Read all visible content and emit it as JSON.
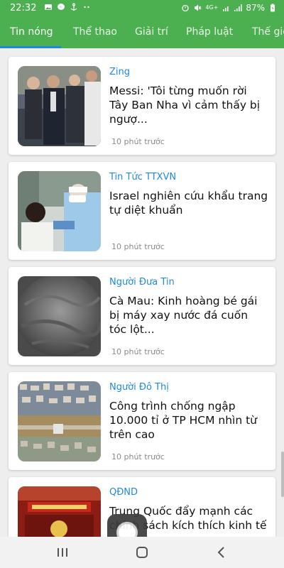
{
  "status_bar": {
    "time": "22:32",
    "network": "4G+",
    "battery": "87%",
    "icons_left": [
      "image-icon",
      "messenger-icon",
      "anchor-icon",
      "more-dots-icon"
    ],
    "icons_right": [
      "alarm-icon",
      "mute-icon",
      "wifi-icon",
      "signal-icon",
      "battery-icon"
    ]
  },
  "tabs": [
    {
      "label": "Tin nóng",
      "active": true
    },
    {
      "label": "Thể thao",
      "active": false
    },
    {
      "label": "Giải trí",
      "active": false
    },
    {
      "label": "Pháp luật",
      "active": false
    },
    {
      "label": "Thế giới",
      "active": false
    }
  ],
  "articles": [
    {
      "source": "Zing",
      "title": "Messi: 'Tôi từng muốn rời Tây Ban Nha vì cảm thấy bị ngượ...",
      "time": "10 phút trước"
    },
    {
      "source": "Tin Tức TTXVN",
      "title": "Israel nghiên cứu khẩu trang tự diệt khuẩn",
      "time": "10 phút trước"
    },
    {
      "source": "Người Đưa Tin",
      "title": "Cà Mau: Kinh hoàng bé gái bị máy xay nước đá cuốn tóc lột...",
      "time": "10 phút trước"
    },
    {
      "source": "Người Đô Thị",
      "title": "Công trình chống ngập 10.000 tỉ ở TP HCM nhìn từ trên cao",
      "time": "10 phút trước"
    },
    {
      "source": "QĐND",
      "title": "Trung Quốc đẩy mạnh các chính sách kích thích kinh tế ...",
      "time": ""
    }
  ],
  "colors": {
    "header": "#4caf50",
    "source": "#1e88e5",
    "indicator": "#1e88e5"
  }
}
